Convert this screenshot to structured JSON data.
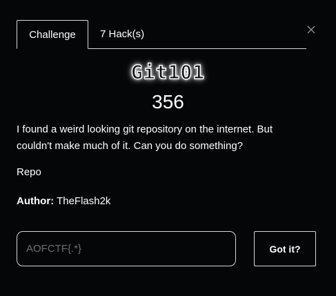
{
  "tabs": [
    {
      "label": "Challenge",
      "active": true
    },
    {
      "label": "7 Hack(s)",
      "active": false
    }
  ],
  "close_icon": "close-icon",
  "challenge": {
    "name": "Git101",
    "value": "356",
    "description": "I found a weird looking git repository on the internet. But couldn't make much of it. Can you do something?",
    "link_label": "Repo",
    "author_label": "Author:",
    "author": "TheFlash2k"
  },
  "submission": {
    "input_value": "",
    "input_placeholder": "AOFCTF{.*}",
    "submit_label": "Got it?"
  },
  "colors": {
    "background": "#040608",
    "text": "#ffffff",
    "border": "#d8d8d8",
    "placeholder": "#6b6f74"
  }
}
